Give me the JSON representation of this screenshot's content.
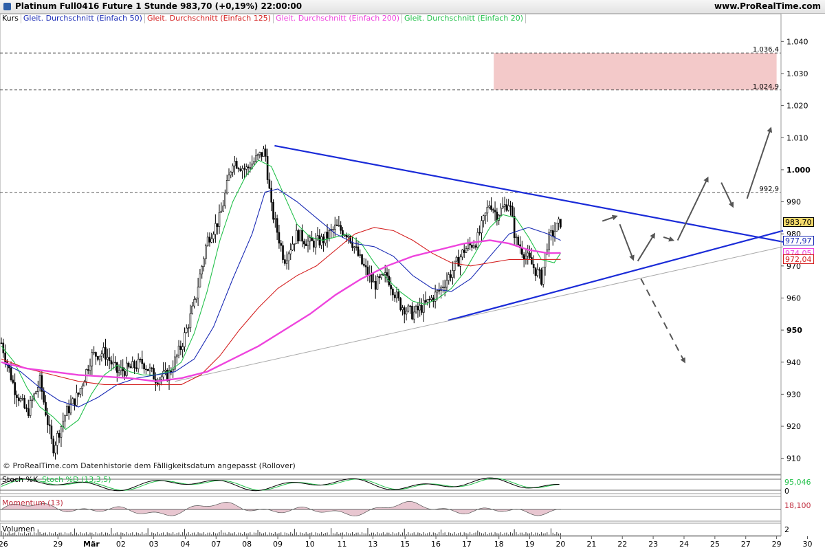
{
  "header": {
    "title": "Platinum Full0416 Future   1 Stunde   983,70 (+0,19%)   22:00:00",
    "brand": "www.ProRealTime.com",
    "copyright": "© ProRealTime.com  Datenhistorie dem Fälligkeitsdatum angepasst (Rollover)"
  },
  "legend": [
    {
      "label": "Kurs",
      "color": "#000000"
    },
    {
      "label": "Gleit. Durchschnitt (Einfach 50)",
      "color": "#1a2bb5"
    },
    {
      "label": "Gleit. Durchschnitt (Einfach 125)",
      "color": "#d42020"
    },
    {
      "label": "Gleit. Durchschnitt (Einfach 200)",
      "color": "#ee44dd"
    },
    {
      "label": "Gleit. Durchschnitt (Einfach 20)",
      "color": "#22c04a"
    }
  ],
  "colors": {
    "ma20": "#22c04a",
    "ma50": "#1a2bb5",
    "ma125": "#d42020",
    "ma200": "#ee44dd",
    "triangle": "#1a2bd8",
    "zone": "#f3c9c9"
  },
  "chart_data": {
    "type": "line",
    "ylim": [
      905,
      1045
    ],
    "y_ticks": [
      910,
      920,
      930,
      940,
      950,
      960,
      970,
      980,
      990,
      1000,
      1010,
      1020,
      1030,
      1040
    ],
    "y_tick_labels": [
      "910",
      "920",
      "930",
      "940",
      "950",
      "960",
      "970",
      "980",
      "990",
      "1.000",
      "1.010",
      "1.020",
      "1.030",
      "1.040"
    ],
    "x_labels": [
      "26",
      "29",
      "Mär",
      "02",
      "03",
      "04",
      "07",
      "08",
      "09",
      "10",
      "11",
      "13",
      "15",
      "16",
      "17",
      "18",
      "19",
      "20",
      "21",
      "22",
      "23",
      "24",
      "25",
      "27",
      "29",
      "30"
    ],
    "x_label_index": [
      3,
      88,
      140,
      186,
      237,
      286,
      334,
      382,
      430,
      480,
      530,
      578,
      628,
      676,
      724,
      774,
      822,
      870,
      918,
      966,
      1014,
      1062,
      1110,
      1158,
      1206,
      1254
    ],
    "x_px_per_index": 0.935,
    "price_close": [
      {
        "x": 0,
        "y": 946
      },
      {
        "x": 20,
        "y": 932
      },
      {
        "x": 40,
        "y": 924
      },
      {
        "x": 60,
        "y": 934
      },
      {
        "x": 80,
        "y": 913
      },
      {
        "x": 100,
        "y": 924
      },
      {
        "x": 120,
        "y": 930
      },
      {
        "x": 140,
        "y": 942
      },
      {
        "x": 160,
        "y": 943
      },
      {
        "x": 180,
        "y": 937
      },
      {
        "x": 200,
        "y": 938
      },
      {
        "x": 220,
        "y": 940
      },
      {
        "x": 240,
        "y": 935
      },
      {
        "x": 260,
        "y": 936
      },
      {
        "x": 280,
        "y": 945
      },
      {
        "x": 300,
        "y": 958
      },
      {
        "x": 320,
        "y": 978
      },
      {
        "x": 340,
        "y": 985
      },
      {
        "x": 360,
        "y": 1003
      },
      {
        "x": 380,
        "y": 1000
      },
      {
        "x": 400,
        "y": 1004
      },
      {
        "x": 410,
        "y": 1006
      },
      {
        "x": 420,
        "y": 988
      },
      {
        "x": 440,
        "y": 972
      },
      {
        "x": 460,
        "y": 980
      },
      {
        "x": 480,
        "y": 977
      },
      {
        "x": 500,
        "y": 978
      },
      {
        "x": 520,
        "y": 982
      },
      {
        "x": 540,
        "y": 980
      },
      {
        "x": 560,
        "y": 971
      },
      {
        "x": 580,
        "y": 964
      },
      {
        "x": 600,
        "y": 967
      },
      {
        "x": 620,
        "y": 958
      },
      {
        "x": 640,
        "y": 955
      },
      {
        "x": 660,
        "y": 958
      },
      {
        "x": 680,
        "y": 962
      },
      {
        "x": 700,
        "y": 968
      },
      {
        "x": 720,
        "y": 975
      },
      {
        "x": 740,
        "y": 978
      },
      {
        "x": 760,
        "y": 990
      },
      {
        "x": 770,
        "y": 986
      },
      {
        "x": 790,
        "y": 990
      },
      {
        "x": 800,
        "y": 978
      },
      {
        "x": 820,
        "y": 972
      },
      {
        "x": 840,
        "y": 966
      },
      {
        "x": 850,
        "y": 978
      },
      {
        "x": 870,
        "y": 983.7
      }
    ],
    "series": [
      {
        "name": "Gleit. Durchschnitt (Einfach 20)",
        "color": "#22c04a",
        "points": [
          {
            "x": 0,
            "y": 945
          },
          {
            "x": 20,
            "y": 940
          },
          {
            "x": 40,
            "y": 932
          },
          {
            "x": 60,
            "y": 926
          },
          {
            "x": 80,
            "y": 923
          },
          {
            "x": 100,
            "y": 919
          },
          {
            "x": 120,
            "y": 922
          },
          {
            "x": 140,
            "y": 930
          },
          {
            "x": 160,
            "y": 936
          },
          {
            "x": 180,
            "y": 939
          },
          {
            "x": 200,
            "y": 937
          },
          {
            "x": 220,
            "y": 936
          },
          {
            "x": 240,
            "y": 936
          },
          {
            "x": 260,
            "y": 937
          },
          {
            "x": 280,
            "y": 940
          },
          {
            "x": 300,
            "y": 949
          },
          {
            "x": 320,
            "y": 962
          },
          {
            "x": 340,
            "y": 978
          },
          {
            "x": 360,
            "y": 990
          },
          {
            "x": 380,
            "y": 998
          },
          {
            "x": 400,
            "y": 1003
          },
          {
            "x": 420,
            "y": 1001
          },
          {
            "x": 440,
            "y": 992
          },
          {
            "x": 460,
            "y": 983
          },
          {
            "x": 480,
            "y": 979
          },
          {
            "x": 500,
            "y": 978
          },
          {
            "x": 520,
            "y": 979
          },
          {
            "x": 540,
            "y": 980
          },
          {
            "x": 560,
            "y": 977
          },
          {
            "x": 580,
            "y": 971
          },
          {
            "x": 600,
            "y": 966
          },
          {
            "x": 620,
            "y": 962
          },
          {
            "x": 640,
            "y": 959
          },
          {
            "x": 660,
            "y": 958
          },
          {
            "x": 680,
            "y": 960
          },
          {
            "x": 700,
            "y": 963
          },
          {
            "x": 720,
            "y": 968
          },
          {
            "x": 740,
            "y": 975
          },
          {
            "x": 760,
            "y": 982
          },
          {
            "x": 780,
            "y": 986
          },
          {
            "x": 800,
            "y": 985
          },
          {
            "x": 820,
            "y": 979
          },
          {
            "x": 840,
            "y": 972
          },
          {
            "x": 860,
            "y": 971
          },
          {
            "x": 870,
            "y": 974
          }
        ]
      },
      {
        "name": "Gleit. Durchschnitt (Einfach 50)",
        "color": "#1a2bb5",
        "points": [
          {
            "x": 0,
            "y": 940
          },
          {
            "x": 30,
            "y": 937
          },
          {
            "x": 60,
            "y": 932
          },
          {
            "x": 90,
            "y": 928
          },
          {
            "x": 120,
            "y": 926
          },
          {
            "x": 150,
            "y": 929
          },
          {
            "x": 180,
            "y": 933
          },
          {
            "x": 210,
            "y": 935
          },
          {
            "x": 240,
            "y": 936
          },
          {
            "x": 270,
            "y": 937
          },
          {
            "x": 300,
            "y": 941
          },
          {
            "x": 330,
            "y": 951
          },
          {
            "x": 360,
            "y": 966
          },
          {
            "x": 390,
            "y": 980
          },
          {
            "x": 410,
            "y": 993
          },
          {
            "x": 430,
            "y": 994
          },
          {
            "x": 460,
            "y": 990
          },
          {
            "x": 490,
            "y": 985
          },
          {
            "x": 520,
            "y": 980
          },
          {
            "x": 550,
            "y": 977
          },
          {
            "x": 580,
            "y": 976
          },
          {
            "x": 610,
            "y": 973
          },
          {
            "x": 640,
            "y": 967
          },
          {
            "x": 670,
            "y": 963
          },
          {
            "x": 700,
            "y": 962
          },
          {
            "x": 730,
            "y": 966
          },
          {
            "x": 760,
            "y": 973
          },
          {
            "x": 790,
            "y": 980
          },
          {
            "x": 820,
            "y": 982
          },
          {
            "x": 850,
            "y": 980
          },
          {
            "x": 870,
            "y": 977.97
          }
        ]
      },
      {
        "name": "Gleit. Durchschnitt (Einfach 125)",
        "color": "#d42020",
        "points": [
          {
            "x": 0,
            "y": 941
          },
          {
            "x": 40,
            "y": 938
          },
          {
            "x": 80,
            "y": 936
          },
          {
            "x": 120,
            "y": 934
          },
          {
            "x": 160,
            "y": 933
          },
          {
            "x": 200,
            "y": 933
          },
          {
            "x": 240,
            "y": 933
          },
          {
            "x": 280,
            "y": 933
          },
          {
            "x": 310,
            "y": 936
          },
          {
            "x": 340,
            "y": 942
          },
          {
            "x": 370,
            "y": 950
          },
          {
            "x": 400,
            "y": 957
          },
          {
            "x": 430,
            "y": 963
          },
          {
            "x": 460,
            "y": 967
          },
          {
            "x": 490,
            "y": 970
          },
          {
            "x": 520,
            "y": 975
          },
          {
            "x": 550,
            "y": 980
          },
          {
            "x": 580,
            "y": 982
          },
          {
            "x": 610,
            "y": 981
          },
          {
            "x": 640,
            "y": 978
          },
          {
            "x": 670,
            "y": 974
          },
          {
            "x": 700,
            "y": 971
          },
          {
            "x": 730,
            "y": 970
          },
          {
            "x": 760,
            "y": 971
          },
          {
            "x": 790,
            "y": 972
          },
          {
            "x": 830,
            "y": 972
          },
          {
            "x": 870,
            "y": 972.04
          }
        ]
      },
      {
        "name": "Gleit. Durchschnitt (Einfach 200)",
        "color": "#ee44dd",
        "points": [
          {
            "x": 0,
            "y": 940
          },
          {
            "x": 40,
            "y": 938
          },
          {
            "x": 80,
            "y": 937
          },
          {
            "x": 120,
            "y": 936
          },
          {
            "x": 160,
            "y": 935.5
          },
          {
            "x": 200,
            "y": 935
          },
          {
            "x": 240,
            "y": 934
          },
          {
            "x": 280,
            "y": 935
          },
          {
            "x": 320,
            "y": 937
          },
          {
            "x": 360,
            "y": 941
          },
          {
            "x": 400,
            "y": 945
          },
          {
            "x": 440,
            "y": 950
          },
          {
            "x": 480,
            "y": 955
          },
          {
            "x": 520,
            "y": 961
          },
          {
            "x": 560,
            "y": 966
          },
          {
            "x": 600,
            "y": 970
          },
          {
            "x": 640,
            "y": 973
          },
          {
            "x": 680,
            "y": 975
          },
          {
            "x": 720,
            "y": 977
          },
          {
            "x": 760,
            "y": 978
          },
          {
            "x": 790,
            "y": 977
          },
          {
            "x": 820,
            "y": 975
          },
          {
            "x": 850,
            "y": 974
          },
          {
            "x": 870,
            "y": 974.05
          }
        ]
      }
    ],
    "levels": [
      {
        "value": 1036.4,
        "label": "1.036,4"
      },
      {
        "value": 1024.9,
        "label": "1.024,9"
      },
      {
        "value": 992.9,
        "label": "992,9"
      }
    ],
    "zone": {
      "x_from": 766,
      "x_to": 1206,
      "y_from": 1024.9,
      "y_to": 1036.4
    },
    "trendlines": [
      {
        "kind": "upper",
        "from": {
          "x": 425,
          "y": 1007.5
        },
        "to": {
          "x": 1216,
          "y": 977.5
        }
      },
      {
        "kind": "lower",
        "from": {
          "x": 695,
          "y": 953
        },
        "to": {
          "x": 1216,
          "y": 981
        }
      },
      {
        "kind": "support",
        "from": {
          "x": 270,
          "y": 934
        },
        "to": {
          "x": 1216,
          "y": 976
        }
      }
    ],
    "scenario_arrows": [
      {
        "from": {
          "x": 935,
          "y": 984
        },
        "to": {
          "x": 957,
          "y": 985.5
        },
        "dashed": false
      },
      {
        "from": {
          "x": 962,
          "y": 983
        },
        "to": {
          "x": 983,
          "y": 972
        },
        "dashed": false
      },
      {
        "from": {
          "x": 990,
          "y": 971.5
        },
        "to": {
          "x": 1016,
          "y": 980
        },
        "dashed": false
      },
      {
        "from": {
          "x": 1030,
          "y": 979
        },
        "to": {
          "x": 1045,
          "y": 978
        },
        "dashed": false
      },
      {
        "from": {
          "x": 1052,
          "y": 978
        },
        "to": {
          "x": 1099,
          "y": 997.5
        },
        "dashed": false
      },
      {
        "from": {
          "x": 1120,
          "y": 996
        },
        "to": {
          "x": 1138,
          "y": 988.5
        },
        "dashed": false
      },
      {
        "from": {
          "x": 1160,
          "y": 991
        },
        "to": {
          "x": 1197,
          "y": 1013
        },
        "dashed": false
      },
      {
        "from": {
          "x": 995,
          "y": 966
        },
        "to": {
          "x": 1063,
          "y": 940
        },
        "dashed": true
      }
    ],
    "price_tags": [
      {
        "value": 983.7,
        "label": "983,70",
        "color": "#000000",
        "bg": "#f3d96b"
      },
      {
        "value": 977.97,
        "label": "977,97",
        "color": "#1a2bb5",
        "bg": "#ffffff"
      },
      {
        "value": 974.05,
        "label": "974,05",
        "color": "#ee44dd",
        "bg": "#ffffff"
      },
      {
        "value": 972.04,
        "label": "972,04",
        "color": "#d42020",
        "bg": "#ffffff"
      }
    ],
    "indicators": {
      "stoch": {
        "label_k": "Stoch %K",
        "label_d": "Stoch %D (13,3,5)",
        "value_label": "95,046",
        "zero_label": "0"
      },
      "momentum": {
        "label": "Momentum (13)",
        "value_label": "18,100"
      },
      "volume": {
        "label": "Volumen",
        "value_label": "2"
      }
    }
  }
}
